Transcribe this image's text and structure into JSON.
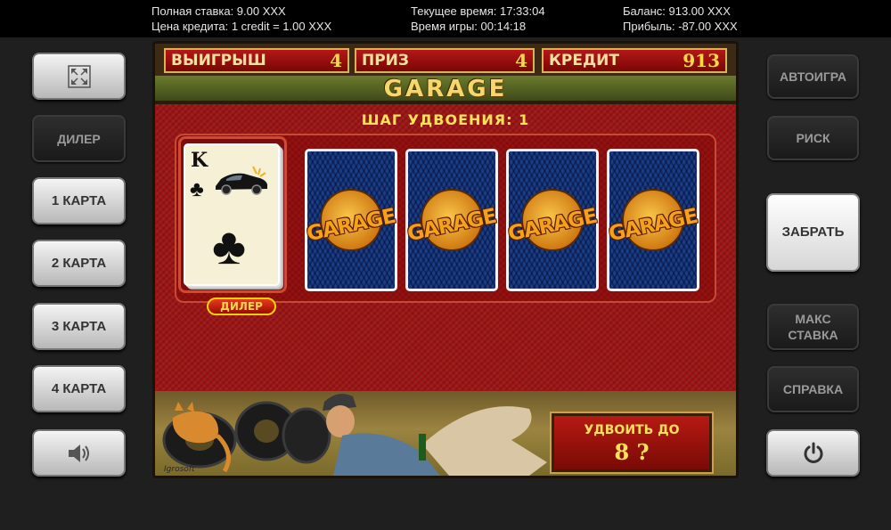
{
  "topbar": {
    "full_bet": "Полная ставка: 9.00 XXX",
    "credit_price": "Цена кредита: 1 credit = 1.00 XXX",
    "current_time": "Текущее время: 17:33:04",
    "game_time": "Время игры: 00:14:18",
    "balance": "Баланс: 913.00 XXX",
    "profit": "Прибыль: -87.00 XXX"
  },
  "left_buttons": {
    "fullscreen_icon": "fullscreen-icon",
    "dealer": "ДИЛЕР",
    "card1": "1 КАРТА",
    "card2": "2 КАРТА",
    "card3": "3 КАРТА",
    "card4": "4 КАРТА",
    "sound_icon": "speaker-icon"
  },
  "right_buttons": {
    "autoplay": "АВТОИГРА",
    "risk": "РИСК",
    "take": "ЗАБРАТЬ",
    "max_bet_line1": "МАКС",
    "max_bet_line2": "СТАВКА",
    "help": "СПРАВКА",
    "power_icon": "power-icon"
  },
  "hud": {
    "win_label": "ВЫИГРЫШ",
    "win_value": "4",
    "prize_label": "ПРИЗ",
    "prize_value": "4",
    "credit_label": "КРЕДИТ",
    "credit_value": "913"
  },
  "game": {
    "logo": "GARAGE",
    "step_label": "ШАГ УДВОЕНИЯ:",
    "step_value": "1",
    "dealer_tag": "ДИЛЕР",
    "dealer_card": {
      "rank": "K",
      "suit": "♣"
    },
    "card_back_text": "GARAGE",
    "double_label": "УДВОИТЬ ДО",
    "double_value": "8 ?",
    "maker": "Igrosoft"
  },
  "colors": {
    "felt": "#9a1414",
    "hud_red": "#b41818",
    "gold": "#ffd94a",
    "card_back": "#1a3f86"
  }
}
